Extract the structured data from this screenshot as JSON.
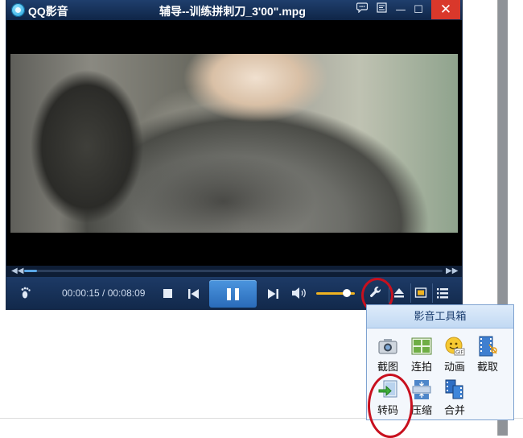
{
  "window": {
    "app_name": "QQ影音",
    "file_title": "辅导--训练拼刺刀_3'00\".mpg",
    "buttons": {
      "chat": "chat-bubble-icon",
      "skin": "skin-icon",
      "minimize": "—",
      "maximize": "☐",
      "close": "✕"
    }
  },
  "seekbar": {
    "rewind": "◀◀",
    "forward": "▶▶",
    "progress": 0.03
  },
  "controls": {
    "time": "00:00:15 / 00:08:09",
    "volume_level": 0.8,
    "accent": "#4b95de"
  },
  "toolbox": {
    "title": "影音工具箱",
    "tools": [
      {
        "label": "截图",
        "icon": "camera-icon"
      },
      {
        "label": "连拍",
        "icon": "burst-shot-icon"
      },
      {
        "label": "动画",
        "icon": "gif-icon"
      },
      {
        "label": "截取",
        "icon": "film-cut-icon"
      },
      {
        "label": "转码",
        "icon": "convert-icon"
      },
      {
        "label": "压缩",
        "icon": "compress-icon"
      },
      {
        "label": "合并",
        "icon": "merge-icon"
      }
    ]
  },
  "annotation_color": "#c8101e"
}
